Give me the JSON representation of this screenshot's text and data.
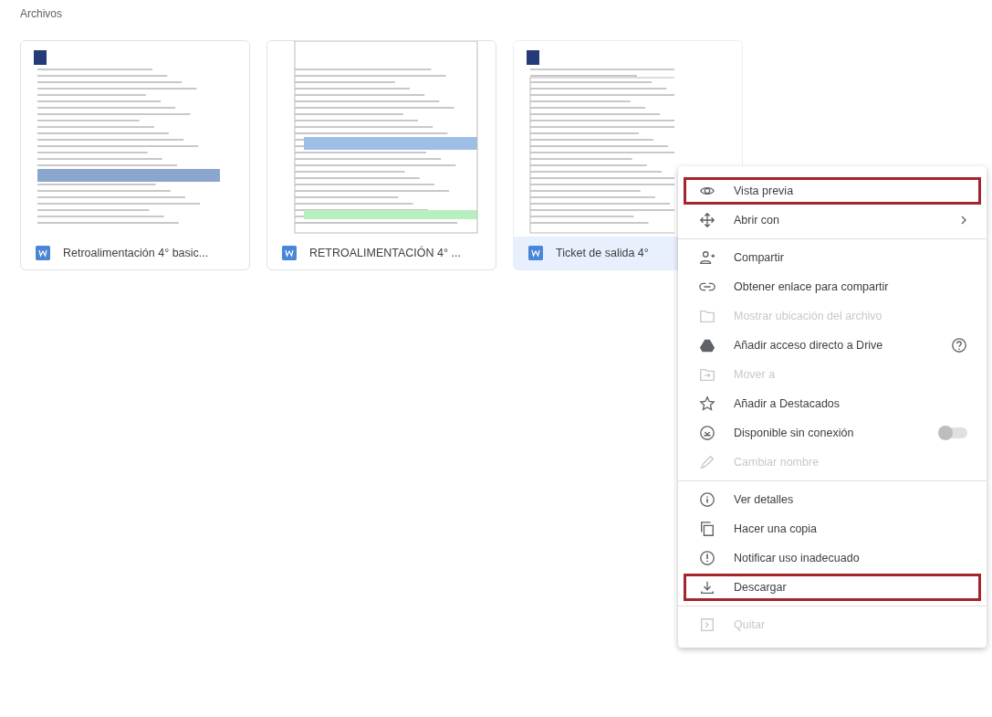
{
  "section_title": "Archivos",
  "files": [
    {
      "name": "Retroalimentación 4° basic...",
      "selected": false
    },
    {
      "name": "RETROALIMENTACIÓN 4° ...",
      "selected": false
    },
    {
      "name": "Ticket de salida 4°",
      "selected": true
    }
  ],
  "context_menu": {
    "sections": [
      [
        {
          "label": "Vista previa",
          "disabled": false,
          "highlighted": true
        },
        {
          "label": "Abrir con",
          "disabled": false,
          "highlighted": false,
          "submenu": true
        }
      ],
      [
        {
          "label": "Compartir",
          "disabled": false,
          "highlighted": false
        },
        {
          "label": "Obtener enlace para compartir",
          "disabled": false,
          "highlighted": false
        },
        {
          "label": "Mostrar ubicación del archivo",
          "disabled": true,
          "highlighted": false
        },
        {
          "label": "Añadir acceso directo a Drive",
          "disabled": false,
          "highlighted": false,
          "help": true
        },
        {
          "label": "Mover a",
          "disabled": true,
          "highlighted": false
        },
        {
          "label": "Añadir a Destacados",
          "disabled": false,
          "highlighted": false
        },
        {
          "label": "Disponible sin conexión",
          "disabled": false,
          "highlighted": false,
          "toggle": {
            "on": false
          }
        },
        {
          "label": "Cambiar nombre",
          "disabled": true,
          "highlighted": false
        }
      ],
      [
        {
          "label": "Ver detalles",
          "disabled": false,
          "highlighted": false
        },
        {
          "label": "Hacer una copia",
          "disabled": false,
          "highlighted": false
        },
        {
          "label": "Notificar uso inadecuado",
          "disabled": false,
          "highlighted": false
        },
        {
          "label": "Descargar",
          "disabled": false,
          "highlighted": true
        }
      ],
      [
        {
          "label": "Quitar",
          "disabled": true,
          "highlighted": false
        }
      ]
    ]
  }
}
